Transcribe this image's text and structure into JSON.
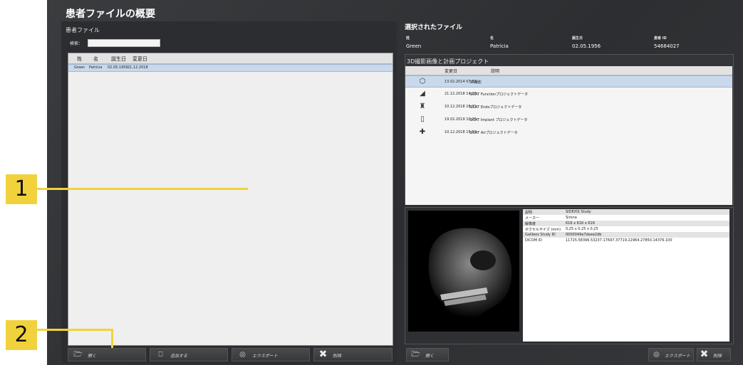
{
  "window": {
    "title": "患者ファイルの概要"
  },
  "left_panel": {
    "title": "患者ファイル",
    "search_label": "検索：",
    "search_value": "",
    "columns": [
      "姓",
      "名",
      "誕生日",
      "変更日"
    ],
    "rows": [
      {
        "last": "Green",
        "first": "Patricia",
        "birth": "02.05.1956",
        "modified": "21.12.2018"
      }
    ],
    "buttons": {
      "open": "開く",
      "add": "追加する",
      "export": "エクスポート",
      "delete": "削除"
    }
  },
  "selected": {
    "title": "選択されたファイル",
    "labels": {
      "last": "姓",
      "first": "名",
      "birth": "誕生日",
      "id": "患者 ID"
    },
    "values": {
      "last": "Green",
      "first": "Patricia",
      "birth": "02.05.1956",
      "id": "54684027"
    }
  },
  "projects": {
    "title": "3D撮影画像と計画プロジェクト",
    "columns": [
      "変更日",
      "説明"
    ],
    "rows": [
      {
        "icon": "cube-icon",
        "date": "13.02.2014 07:52",
        "desc": "3D撮影"
      },
      {
        "icon": "jaw-icon",
        "date": "21.12.2018 14:28",
        "desc": "SICAT Functionプロジェクトデータ"
      },
      {
        "icon": "tooth-icon",
        "date": "10.12.2018 16:01",
        "desc": "SICAT Endoプロジェクトデータ"
      },
      {
        "icon": "implant-icon",
        "date": "19.02.2019 10:26",
        "desc": "SICAT Implant プロジェクトデータ"
      },
      {
        "icon": "airway-icon",
        "date": "10.12.2018 15:59",
        "desc": "SICAT Airプロジェクトデータ"
      }
    ]
  },
  "details": [
    {
      "key": "説明",
      "value": "SIDEXIS Study"
    },
    {
      "key": "メーカー",
      "value": "Sirona"
    },
    {
      "key": "解像度",
      "value": "616 x 616 x 616"
    },
    {
      "key": "ボクセルサイズ (mm)",
      "value": "0,25 x 0,25 x 0,25"
    },
    {
      "key": "Galileos Study ID",
      "value": "0000049a7deee2db"
    },
    {
      "key": "DICOM ID",
      "value": "11725.58396.53237.17697.37719.22964.27850.14376.100"
    }
  ],
  "right_buttons": {
    "open": "開く",
    "export": "エクスポート",
    "delete": "削除"
  },
  "callouts": [
    "1",
    "2"
  ],
  "colors": {
    "callout": "#f2d23c",
    "selection": "#c9d9eb",
    "background": "#2c2e31"
  }
}
